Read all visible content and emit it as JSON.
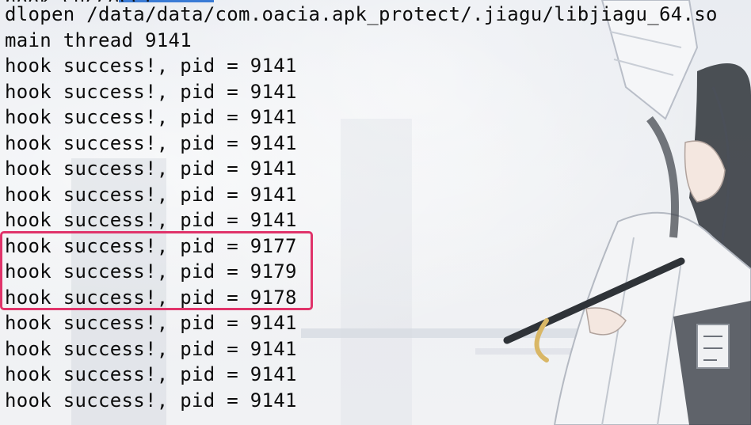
{
  "terminal": {
    "lines": [
      "dlopen /data/data/com.oacia.apk_protect/.jiagu/libjiagu_64.so",
      "main thread 9141",
      "hook success!, pid = 9141",
      "hook success!, pid = 9141",
      "hook success!, pid = 9141",
      "hook success!, pid = 9141",
      "hook success!, pid = 9141",
      "hook success!, pid = 9141",
      "hook success!, pid = 9141",
      "hook success!, pid = 9177",
      "hook success!, pid = 9179",
      "hook success!, pid = 9178",
      "hook success!, pid = 9141",
      "hook success!, pid = 9141",
      "hook success!, pid = 9141",
      "hook success!, pid = 9141"
    ]
  },
  "colors": {
    "text": "#0c0c0c",
    "highlight_border": "#e0336a",
    "selection_accent": "#3a7bd5",
    "background": "#eef0f3"
  }
}
